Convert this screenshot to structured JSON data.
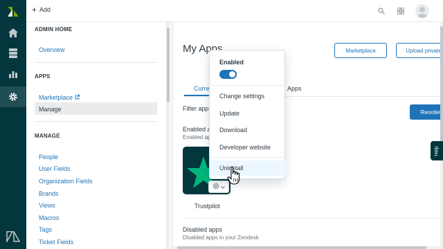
{
  "topbar": {
    "add_label": "Add"
  },
  "sidebar": {
    "admin_home_heading": "ADMIN HOME",
    "overview_label": "Overview",
    "apps_heading": "APPS",
    "marketplace_label": "Marketplace",
    "manage_label": "Manage",
    "manage_heading": "MANAGE",
    "manage_items": [
      "People",
      "User Fields",
      "Organization Fields",
      "Brands",
      "Views",
      "Macros",
      "Tags",
      "Ticket Fields"
    ]
  },
  "main": {
    "title": "My Apps",
    "marketplace_button": "Marketplace",
    "upload_button": "Upload private",
    "tabs": [
      {
        "label": "Curre"
      },
      {
        "label": "Apps"
      }
    ],
    "filter_label": "Filter apps",
    "reorder_button": "Reorder",
    "enabled_title": "Enabled app",
    "enabled_subtitle": "Enabled ap",
    "app_name": "Trustpilot",
    "disabled_title": "Disabled apps",
    "disabled_subtitle": "Disabled apps in your Zendesk"
  },
  "menu": {
    "header": "Enabled",
    "toggle_on": true,
    "items": [
      "Change settings",
      "Update",
      "Download",
      "Developer website",
      "Uninstall"
    ]
  },
  "help_label": "Help",
  "colors": {
    "rail": "#03363d",
    "accent": "#1f73b7",
    "trustpilot_green": "#00b67a"
  }
}
